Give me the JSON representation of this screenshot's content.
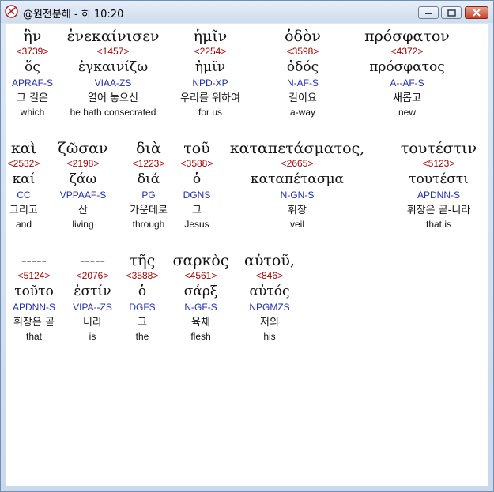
{
  "window": {
    "title": "@원전분해 - 히 10:20",
    "minimize_label": "minimize",
    "maximize_label": "maximize",
    "close_label": "close"
  },
  "rows": [
    [
      {
        "greek": "ἣν",
        "strong": "<3739>",
        "lemma": "ὅς",
        "parse": "APRAF-S",
        "korean": "그 길은",
        "english": "which"
      },
      {
        "greek": "ἐνεκαίνισεν",
        "strong": "<1457>",
        "lemma": "ἐγκαινίζω",
        "parse": "VIAA-ZS",
        "korean": "열어 놓으신",
        "english": "he hath consecrated"
      },
      {
        "greek": "ἡμῖν",
        "strong": "<2254>",
        "lemma": "ἡμῖν",
        "parse": "NPD-XP",
        "korean": "우리를 위하여",
        "english": "for us"
      },
      {
        "greek": "ὁδὸν",
        "strong": "<3598>",
        "lemma": "ὁδός",
        "parse": "N-AF-S",
        "korean": "길이요",
        "english": "a-way"
      },
      {
        "greek": "πρόσφατον",
        "strong": "<4372>",
        "lemma": "πρόσφατος",
        "parse": "A--AF-S",
        "korean": "새롭고",
        "english": "new"
      }
    ],
    [
      {
        "greek": "καὶ",
        "strong": "<2532>",
        "lemma": "καί",
        "parse": "CC",
        "korean": "그리고",
        "english": "and"
      },
      {
        "greek": "ζῶσαν",
        "strong": "<2198>",
        "lemma": "ζάω",
        "parse": "VPPAAF-S",
        "korean": "산",
        "english": "living"
      },
      {
        "greek": "διὰ",
        "strong": "<1223>",
        "lemma": "διά",
        "parse": "PG",
        "korean": "가운데로",
        "english": "through"
      },
      {
        "greek": "τοῦ",
        "strong": "<3588>",
        "lemma": "ὁ",
        "parse": "DGNS",
        "korean": "그",
        "english": "Jesus"
      },
      {
        "greek": "καταπετάσματος,",
        "strong": "<2665>",
        "lemma": "καταπέτασμα",
        "parse": "N-GN-S",
        "korean": "휘장",
        "english": "veil"
      },
      {
        "greek": "τουτέστιν",
        "strong": "<5123>",
        "lemma": "τουτέστι",
        "parse": "APDNN-S",
        "korean": "휘장은 곧-니라",
        "english": "that is"
      }
    ],
    [
      {
        "greek": "-----",
        "strong": "<5124>",
        "lemma": "τοῦτο",
        "parse": "APDNN-S",
        "korean": "휘장은 곧",
        "english": "that"
      },
      {
        "greek": "-----",
        "strong": "<2076>",
        "lemma": "ἐστίν",
        "parse": "VIPA--ZS",
        "korean": "니라",
        "english": "is"
      },
      {
        "greek": "τῆς",
        "strong": "<3588>",
        "lemma": "ὁ",
        "parse": "DGFS",
        "korean": "그",
        "english": "the"
      },
      {
        "greek": "σαρκὸς",
        "strong": "<4561>",
        "lemma": "σάρξ",
        "parse": "N-GF-S",
        "korean": "육체",
        "english": "flesh"
      },
      {
        "greek": "αὐτοῦ,",
        "strong": "<846>",
        "lemma": "αὐτός",
        "parse": "NPGMZS",
        "korean": "저의",
        "english": "his"
      }
    ]
  ]
}
